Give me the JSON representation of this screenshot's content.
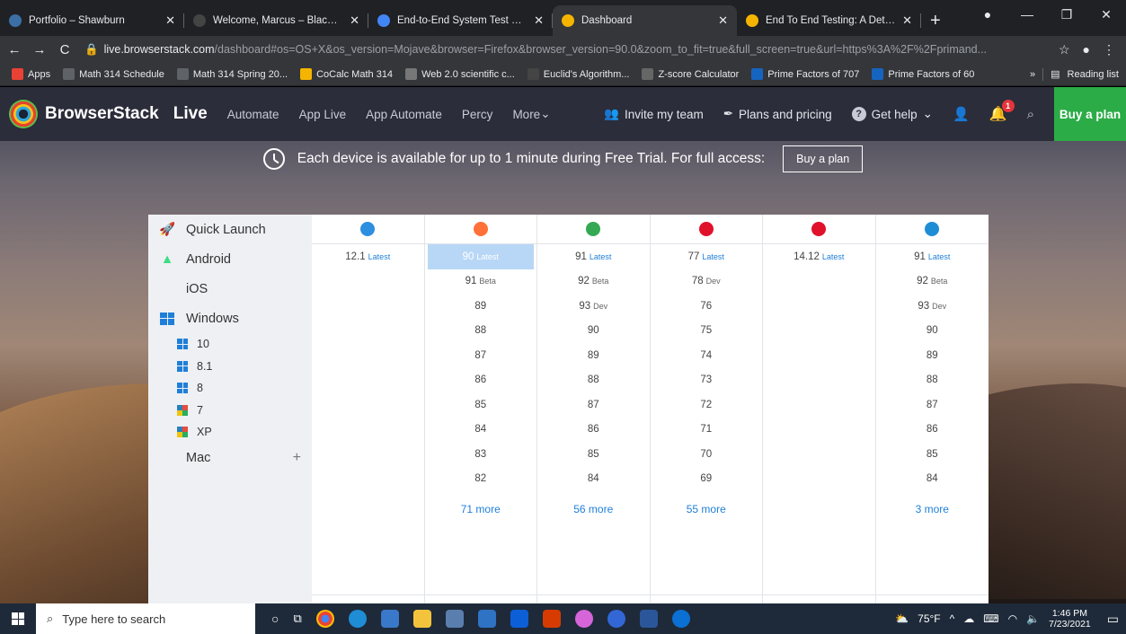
{
  "browser": {
    "tabs": [
      {
        "title": "Portfolio – Shawburn",
        "favicon_color": "#3b6fa5"
      },
      {
        "title": "Welcome, Marcus – Blackboa",
        "favicon_color": "#444"
      },
      {
        "title": "End-to-End System Test Proc",
        "favicon_color": "#4285f4"
      },
      {
        "title": "Dashboard",
        "favicon_color": "#f4b400"
      },
      {
        "title": "End To End Testing: A Detaile",
        "favicon_color": "#f4b400"
      }
    ],
    "url_host": "live.browserstack.com",
    "url_rest": "/dashboard#os=OS+X&os_version=Mojave&browser=Firefox&browser_version=90.0&zoom_to_fit=true&full_screen=true&url=https%3A%2F%2Fprimand...",
    "bookmarks": [
      {
        "label": "Apps",
        "color": "#e94235"
      },
      {
        "label": "Math 314 Schedule",
        "color": "#5f6368"
      },
      {
        "label": "Math 314 Spring 20...",
        "color": "#5f6368"
      },
      {
        "label": "CoCalc Math 314",
        "color": "#f4b400"
      },
      {
        "label": "Web 2.0 scientific c...",
        "color": "#777"
      },
      {
        "label": "Euclid's Algorithm...",
        "color": "#444"
      },
      {
        "label": "Z-score Calculator",
        "color": "#666"
      },
      {
        "label": "Prime Factors of 707",
        "color": "#1565c0"
      },
      {
        "label": "Prime Factors of 60",
        "color": "#1565c0"
      }
    ],
    "bookmarks_overflow": "»",
    "reading_list": "Reading list"
  },
  "header": {
    "brand": "BrowserStack",
    "product": "Live",
    "nav": [
      "Automate",
      "App Live",
      "App Automate",
      "Percy",
      "More"
    ],
    "invite": "Invite my team",
    "plans": "Plans and pricing",
    "help": "Get help",
    "notification_count": "1",
    "buy_plan": "Buy a plan"
  },
  "trial": {
    "message": "Each device is available for up to 1 minute during Free Trial. For full access:",
    "button": "Buy a plan"
  },
  "os_menu": {
    "items": [
      "Quick Launch",
      "Android",
      "iOS",
      "Windows"
    ],
    "windows_versions": [
      "10",
      "8.1",
      "8",
      "7",
      "XP"
    ],
    "mac": "Mac",
    "mac_expand": "+"
  },
  "browsers": [
    {
      "name": "safari",
      "color": "#2d8fe0",
      "versions": [
        {
          "v": "12.1",
          "tag": "Latest",
          "tagtype": "latest"
        }
      ],
      "more": ""
    },
    {
      "name": "firefox",
      "color": "#ff7139",
      "versions": [
        {
          "v": "90",
          "tag": "Latest",
          "tagtype": "latest",
          "selected": true
        },
        {
          "v": "91",
          "tag": "Beta",
          "tagtype": "grey"
        },
        {
          "v": "89"
        },
        {
          "v": "88"
        },
        {
          "v": "87"
        },
        {
          "v": "86"
        },
        {
          "v": "85"
        },
        {
          "v": "84"
        },
        {
          "v": "83"
        },
        {
          "v": "82"
        }
      ],
      "more": "71 more"
    },
    {
      "name": "chrome",
      "color": "#34a853",
      "versions": [
        {
          "v": "91",
          "tag": "Latest",
          "tagtype": "latest"
        },
        {
          "v": "92",
          "tag": "Beta",
          "tagtype": "grey"
        },
        {
          "v": "93",
          "tag": "Dev",
          "tagtype": "grey"
        },
        {
          "v": "90"
        },
        {
          "v": "89"
        },
        {
          "v": "88"
        },
        {
          "v": "87"
        },
        {
          "v": "86"
        },
        {
          "v": "85"
        },
        {
          "v": "84"
        }
      ],
      "more": "56 more"
    },
    {
      "name": "opera",
      "color": "#e0112b",
      "versions": [
        {
          "v": "77",
          "tag": "Latest",
          "tagtype": "latest"
        },
        {
          "v": "78",
          "tag": "Dev",
          "tagtype": "grey"
        },
        {
          "v": "76"
        },
        {
          "v": "75"
        },
        {
          "v": "74"
        },
        {
          "v": "73"
        },
        {
          "v": "72"
        },
        {
          "v": "71"
        },
        {
          "v": "70"
        },
        {
          "v": "69"
        }
      ],
      "more": "55 more"
    },
    {
      "name": "yandex",
      "color": "#e0112b",
      "versions": [
        {
          "v": "14.12",
          "tag": "Latest",
          "tagtype": "latest"
        }
      ],
      "more": ""
    },
    {
      "name": "edge",
      "color": "#1f8dd6",
      "versions": [
        {
          "v": "91",
          "tag": "Latest",
          "tagtype": "latest"
        },
        {
          "v": "92",
          "tag": "Beta",
          "tagtype": "grey"
        },
        {
          "v": "93",
          "tag": "Dev",
          "tagtype": "grey"
        },
        {
          "v": "90"
        },
        {
          "v": "89"
        },
        {
          "v": "88"
        },
        {
          "v": "87"
        },
        {
          "v": "86"
        },
        {
          "v": "85"
        },
        {
          "v": "84"
        }
      ],
      "more": "3 more"
    }
  ],
  "taskbar": {
    "search_placeholder": "Type here to search",
    "weather": "75°F",
    "time": "1:46 PM",
    "date": "7/23/2021"
  }
}
